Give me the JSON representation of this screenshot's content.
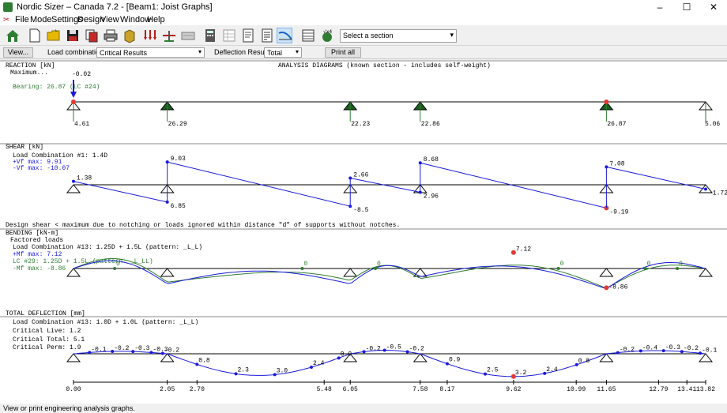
{
  "window": {
    "title": "Nordic Sizer – Canada 7.2 - [Beam1: Joist Graphs]",
    "min": "–",
    "max": "☐",
    "close": "✕"
  },
  "menu": [
    "File",
    "Mode",
    "Settings",
    "Design",
    "View",
    "Window",
    "Help"
  ],
  "toolbar": {
    "icons": [
      "home-icon",
      "new-file-icon",
      "open-folder-icon",
      "save-icon",
      "copy-icon",
      "print-icon",
      "material-icon",
      "loads-icon",
      "supports-icon",
      "section-icon",
      "calculator-icon",
      "table-icon",
      "report-icon",
      "notes-icon",
      "graph-icon",
      "spreadsheet-icon",
      "formula-icon"
    ],
    "section_select": "Select a section"
  },
  "options": {
    "view_button": "View...",
    "load_comb_label": "Load combinations:",
    "load_comb_value": "Critical Results",
    "deflection_label": "Deflection Results:",
    "deflection_value": "Total",
    "print_button": "Print all"
  },
  "diagram_title": "ANALYSIS DIAGRAMS (known section - includes self-weight)",
  "supports_x": [
    0.0,
    2.05,
    6.05,
    7.58,
    11.65,
    13.82
  ],
  "reaction": {
    "header": "REACTION [kN]",
    "maximum": "Maximum...",
    "bearing": "Bearing:  26.87 (LC #24)",
    "uplift": "-0.02",
    "values": [
      "4.61",
      "26.29",
      "22.23",
      "22.86",
      "26.87",
      "5.06"
    ]
  },
  "shear": {
    "header": "SHEAR [kN]",
    "lc": "Load Combination #1: 1.4D",
    "vf_max": "+Vf max:     9.91",
    "vf_min": "-Vf max:   -10.07",
    "points": [
      [
        0.0,
        1.38
      ],
      [
        2.05,
        -6.85
      ],
      [
        2.05,
        9.03
      ],
      [
        6.05,
        -8.5
      ],
      [
        6.05,
        2.66
      ],
      [
        7.58,
        -2.96
      ],
      [
        7.58,
        8.68
      ],
      [
        11.65,
        -9.19
      ],
      [
        11.65,
        7.08
      ],
      [
        13.82,
        -1.72
      ]
    ],
    "labels": [
      "1.38",
      "6.85",
      "9.03",
      "-8.5",
      "2.66",
      "2.96",
      "8.68",
      "-9.19",
      "7.08",
      "-1.72"
    ]
  },
  "note": "Design shear < maximum due to notching or loads ignored within distance \"d\" of supports without notches.",
  "bending": {
    "header": "BENDING [kN-m]",
    "factored": "Factored loads",
    "lc1": "Load Combination #13: 1.25D + 1.5L (pattern: _L_L)",
    "mf_max": "+Mf max:     7.12",
    "lc2": "LC #29: 1.25D + 1.5L (pattern: _L_LL)",
    "mf_min": "-Mf max:   -8.86",
    "max_label": "7.12",
    "min_label": "-8.86",
    "zero": "0"
  },
  "deflection": {
    "header": "TOTAL DEFLECTION [mm]",
    "lc": "Load Combination #13: 1.0D + 1.0L (pattern: _L_L)",
    "crit_live": "Critical Live:  1.2",
    "crit_total": "Critical Total: 5.1",
    "crit_perm": "Critical Perm:  1.9",
    "labels": [
      "-0.1",
      "-0.2",
      "-0.3",
      "-0.3",
      "-0.2",
      "0.8",
      "2.3",
      "3.0",
      "2.4",
      "0.9",
      "-0.2",
      "-0.5",
      "-0.2",
      "0.9",
      "2.5",
      "3.2",
      "2.4",
      "0.8",
      "-0.2",
      "-0.4",
      "-0.3",
      "-0.2",
      "-0.1"
    ]
  },
  "x_axis": [
    "0.00",
    "2.05",
    "2.70",
    "5.48",
    "6.05",
    "7.58",
    "8.17",
    "9.62",
    "10.99",
    "11.65",
    "12.79",
    "13.41",
    "13.82"
  ],
  "status": "View or print engineering analysis graphs."
}
